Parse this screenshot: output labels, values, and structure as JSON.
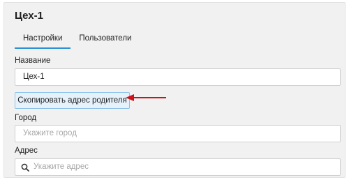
{
  "header": {
    "title": "Цех-1"
  },
  "tabs": [
    {
      "label": "Настройки",
      "active": true
    },
    {
      "label": "Пользователи",
      "active": false
    }
  ],
  "form": {
    "name": {
      "label": "Название",
      "value": "Цех-1"
    },
    "copy_button": {
      "label": "Скопировать адрес родителя"
    },
    "city": {
      "label": "Город",
      "value": "",
      "placeholder": "Укажите город"
    },
    "address": {
      "label": "Адрес",
      "value": "",
      "placeholder": "Укажите адрес",
      "icon": "search-icon"
    }
  },
  "annotation": {
    "icon": "arrow-left-icon",
    "color": "#d0111b"
  },
  "colors": {
    "accent": "#2b8fd6",
    "button_bg": "#e6f2fb",
    "button_border": "#8fc1e8",
    "panel_bg": "#f1f1f1"
  }
}
